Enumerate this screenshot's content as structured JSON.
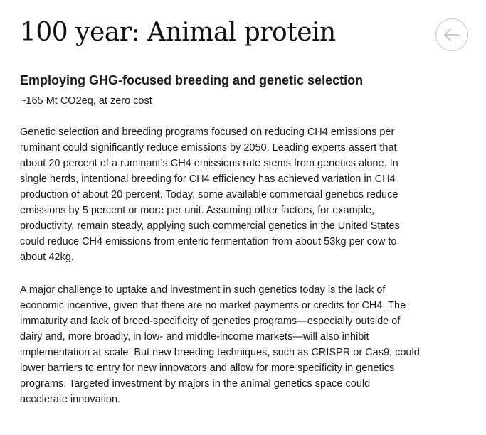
{
  "header": {
    "title": "100 year: Animal protein",
    "back_icon": "arrow-left-icon",
    "icon_color": "#c8c8c8"
  },
  "section": {
    "title": "Employing GHG-focused breeding and genetic selection",
    "impact": "~165 Mt CO2eq, at zero cost"
  },
  "paragraphs": [
    {
      "lines": [
        "Genetic selection and breeding programs focused on reducing CH4 emissions per",
        "ruminant could significantly reduce emissions by 2050. Leading experts assert that",
        "about 20 percent of a ruminant’s CH4 emissions rate stems from genetics alone. In",
        "single herds, intentional breeding for CH4 efficiency has achieved variation in CH4",
        "production of about 20 percent. Today, some available commercial genetics reduce",
        "emissions by 5 percent or more per unit. Assuming other factors, for example,",
        "productivity, remain steady, applying such commercial genetics in the United States",
        "could reduce CH4 emissions from enteric fermentation from about 53kg per cow to",
        "about 42kg."
      ]
    },
    {
      "lines": [
        "A major challenge to uptake and investment in such genetics today is the lack of",
        "economic incentive, given that there are no market payments or credits for CH4. The",
        "immaturity and lack of breed-specificity of genetics programs—especially outside of",
        "dairy and, more broadly, in low- and middle-income markets—will also inhibit",
        "implementation at scale. But new breeding techniques, such as CRISPR or Cas9, could",
        "lower barriers to entry for new innovators and allow for more specificity in genetics",
        "programs. Targeted investment by majors in the animal genetics space could",
        "accelerate innovation."
      ]
    }
  ]
}
